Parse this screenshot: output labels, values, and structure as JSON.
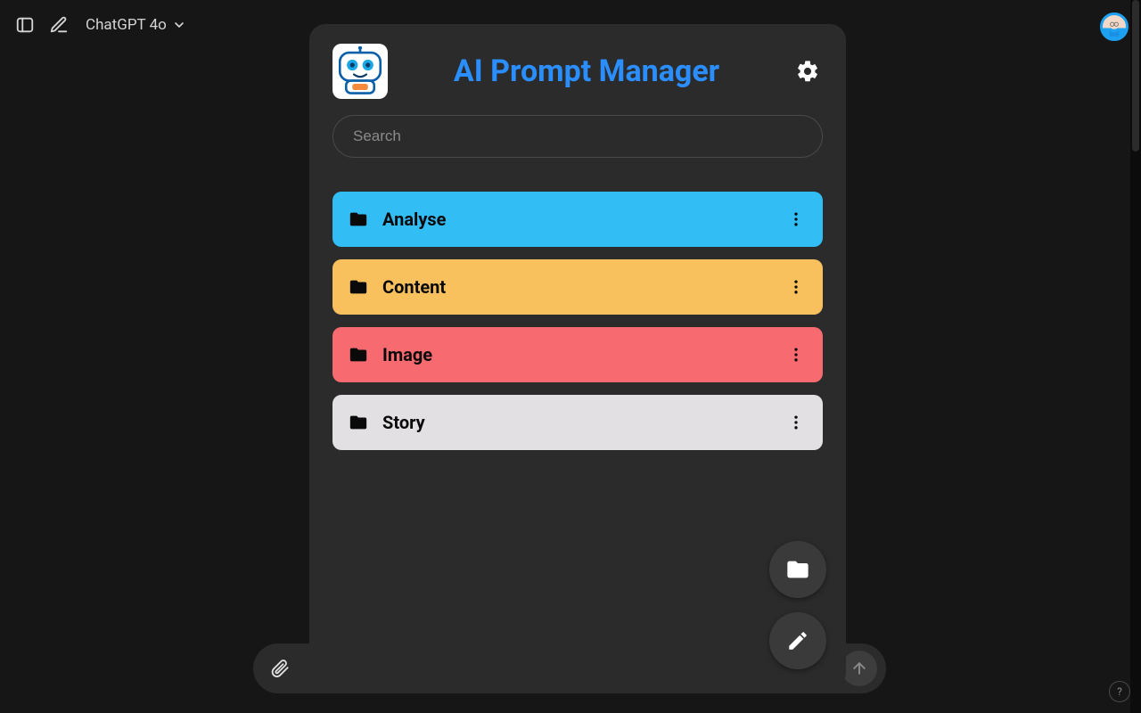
{
  "topbar": {
    "model_label": "ChatGPT 4o"
  },
  "panel": {
    "title": "AI Prompt Manager",
    "search_placeholder": "Search"
  },
  "folders": [
    {
      "label": "Analyse",
      "color": "#33bdf5"
    },
    {
      "label": "Content",
      "color": "#f8c15d"
    },
    {
      "label": "Image",
      "color": "#f76a6f"
    },
    {
      "label": "Story",
      "color": "#e3e0e3"
    }
  ],
  "help_label": "?"
}
